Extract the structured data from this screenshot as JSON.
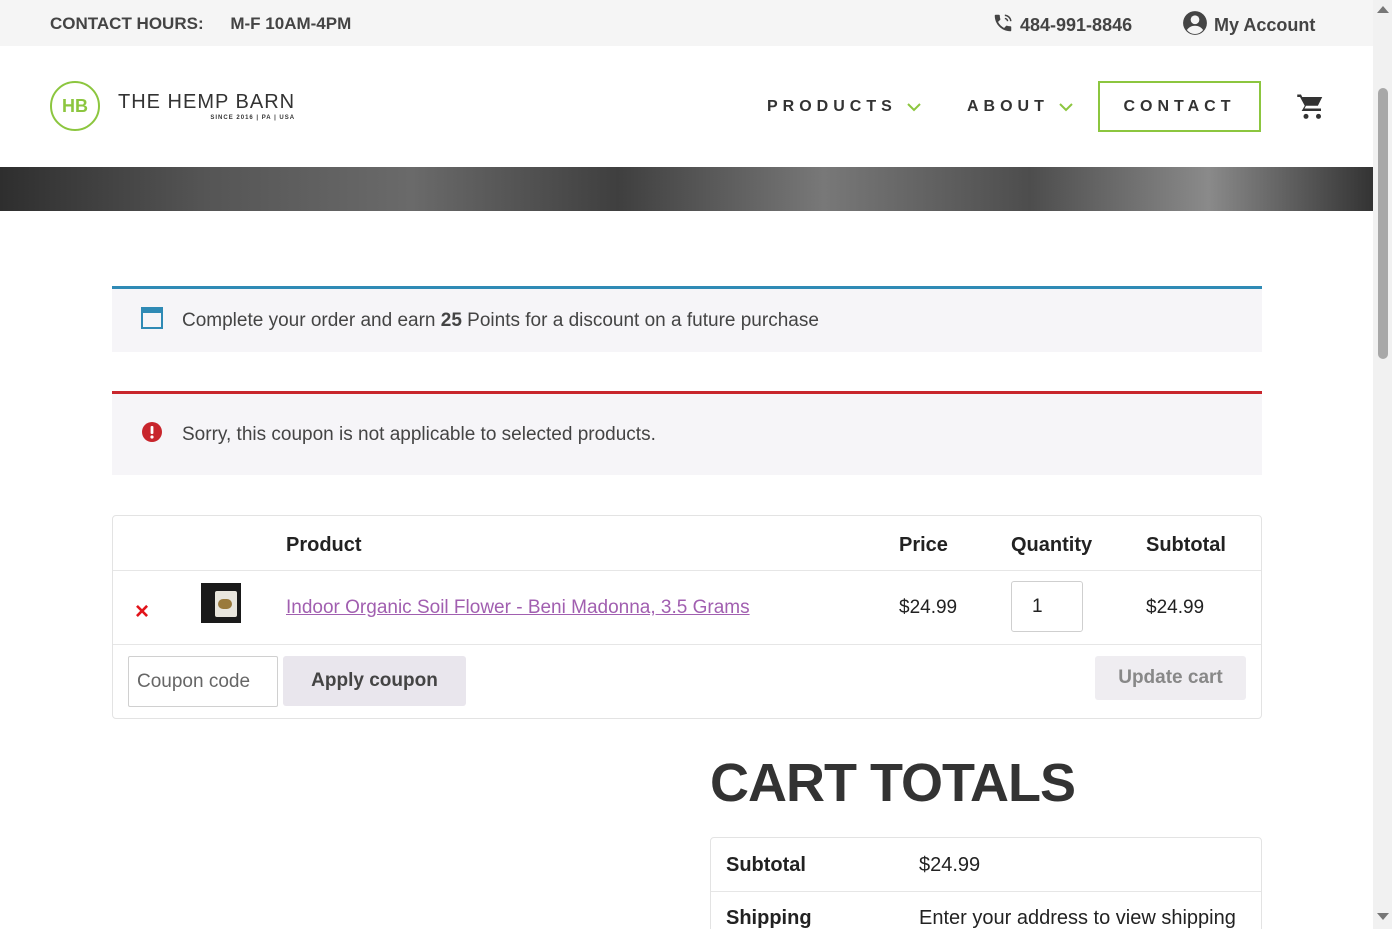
{
  "topbar": {
    "hours_label": "CONTACT HOURS:",
    "hours_value": "M-F 10AM-4PM",
    "phone": "484-991-8846",
    "account": "My Account"
  },
  "header": {
    "logo_mark": "HB",
    "logo_name": "THE HEMP BARN",
    "logo_tagline": "SINCE 2016 | PA | USA",
    "nav": {
      "products": "PRODUCTS",
      "about": "ABOUT",
      "contact": "CONTACT"
    }
  },
  "notices": {
    "info_prefix": "Complete your order and earn ",
    "info_points": "25",
    "info_suffix": " Points for a discount on a future purchase",
    "error": "Sorry, this coupon is not applicable to selected products."
  },
  "cart": {
    "headers": {
      "product": "Product",
      "price": "Price",
      "quantity": "Quantity",
      "subtotal": "Subtotal"
    },
    "items": [
      {
        "remove": "×",
        "name": "Indoor Organic Soil Flower - Beni Madonna, 3.5 Grams",
        "price": "$24.99",
        "quantity": "1",
        "subtotal": "$24.99"
      }
    ],
    "coupon_placeholder": "Coupon code",
    "apply_label": "Apply coupon",
    "update_label": "Update cart"
  },
  "totals": {
    "title": "CART TOTALS",
    "subtotal_label": "Subtotal",
    "subtotal_value": "$24.99",
    "shipping_label": "Shipping",
    "shipping_value": "Enter your address to view shipping"
  },
  "colors": {
    "brand_green": "#8cc63f",
    "info_border": "#2f8ab5",
    "error_border": "#c8252c",
    "link_purple": "#a15fb0",
    "remove_red": "#e2141b"
  },
  "icons": [
    "phone-icon",
    "account-icon",
    "chevron-down-icon",
    "cart-icon",
    "info-icon",
    "error-icon",
    "remove-icon"
  ]
}
